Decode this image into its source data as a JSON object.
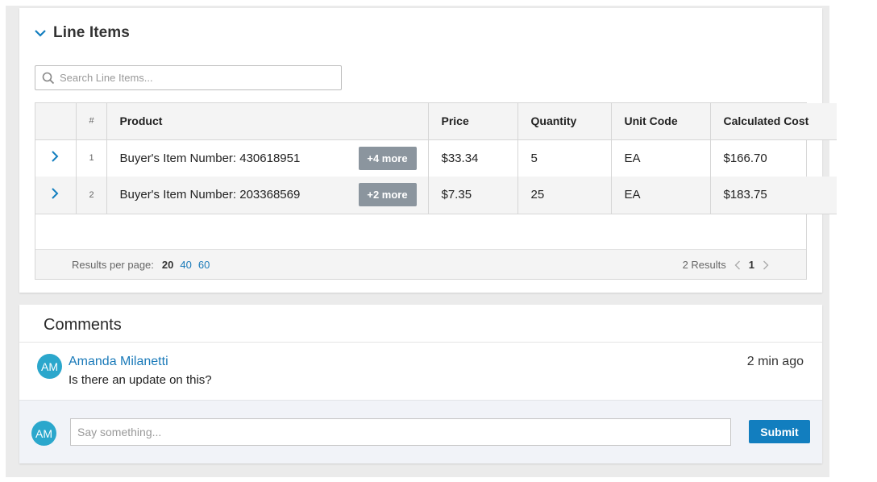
{
  "line_items": {
    "title": "Line Items",
    "search_placeholder": "Search Line Items...",
    "columns": {
      "num": "#",
      "product": "Product",
      "price": "Price",
      "quantity": "Quantity",
      "unit_code": "Unit Code",
      "calculated_cost": "Calculated Cost"
    },
    "rows": [
      {
        "num": "1",
        "product": "Buyer's Item Number: 430618951",
        "more": "+4 more",
        "price": "$33.34",
        "quantity": "5",
        "unit_code": "EA",
        "cost": "$166.70"
      },
      {
        "num": "2",
        "product": "Buyer's Item Number: 203368569",
        "more": "+2 more",
        "price": "$7.35",
        "quantity": "25",
        "unit_code": "EA",
        "cost": "$183.75"
      }
    ],
    "footer": {
      "results_per_page_label": "Results per page:",
      "per_page_selected": "20",
      "per_page_options": [
        "40",
        "60"
      ],
      "results_count": "2 Results",
      "current_page": "1"
    }
  },
  "comments": {
    "title": "Comments",
    "items": [
      {
        "initials": "AM",
        "author": "Amanda Milanetti",
        "text": "Is there an update on this?",
        "time": "2 min ago"
      }
    ],
    "composer": {
      "initials": "AM",
      "placeholder": "Say something...",
      "submit_label": "Submit"
    }
  },
  "colors": {
    "accent": "#127ebf",
    "link": "#1a7ab9",
    "avatar": "#2ba7cc",
    "badge": "#8b959e"
  }
}
